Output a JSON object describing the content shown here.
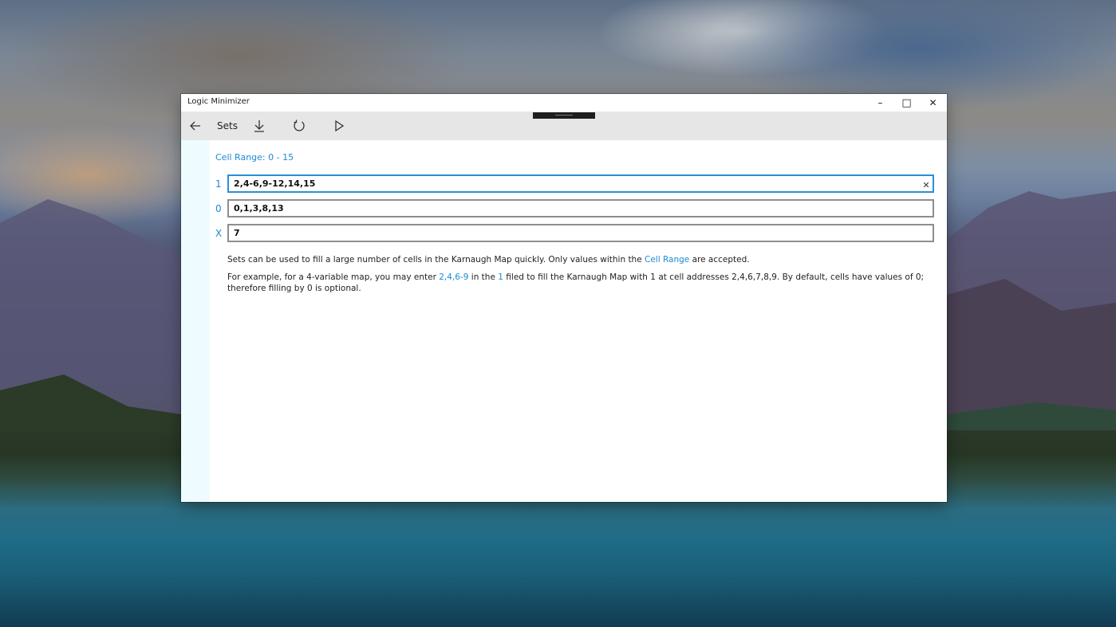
{
  "window": {
    "title": "Logic Minimizer",
    "minimize_glyph": "–",
    "maximize_glyph": "□",
    "close_glyph": "✕"
  },
  "toolbar": {
    "back_icon": "back-arrow-icon",
    "title": "Sets",
    "buttons": [
      {
        "name": "download-icon"
      },
      {
        "name": "reset-icon"
      },
      {
        "name": "play-icon"
      }
    ]
  },
  "content": {
    "cell_range_label": "Cell Range: 0 - 15",
    "rows": [
      {
        "label": "1",
        "value": "2,4-6,9-12,14,15"
      },
      {
        "label": "0",
        "value": "0,1,3,8,13"
      },
      {
        "label": "X",
        "value": "7"
      }
    ],
    "clear_glyph": "✕",
    "desc1": {
      "before": "Sets can be used to fill a large number of cells in the Karnaugh Map quickly. Only values within the ",
      "link": "Cell Range",
      "after": " are accepted."
    },
    "desc2": {
      "part1": "For example, for a 4-variable map, you may enter ",
      "link1": "2,4,6-9",
      "part2": "  in the ",
      "link2": "1",
      "part3": "  filed to fill the Karnaugh Map with 1 at cell addresses 2,4,6,7,8,9. By default, cells have values of 0; therefore filling by 0 is optional."
    }
  },
  "colors": {
    "accent": "#1a8ad4",
    "toolbar_bg": "#e6e6e6",
    "rail_bg": "#eefcff"
  }
}
